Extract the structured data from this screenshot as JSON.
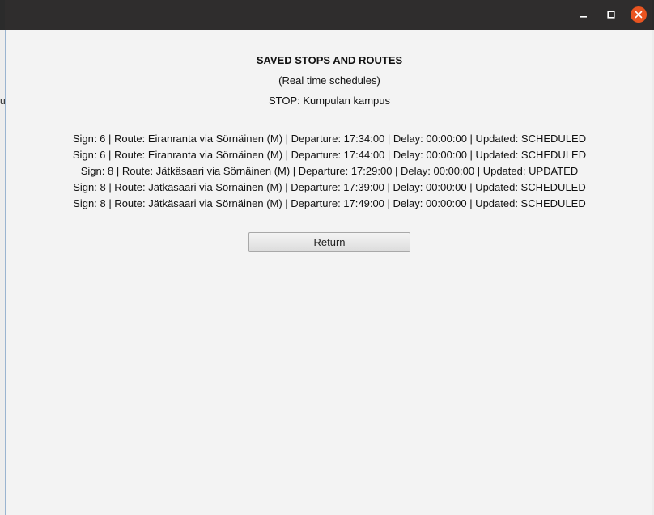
{
  "window": {
    "controls": {
      "minimize_icon": "minimize-icon",
      "maximize_icon": "maximize-icon",
      "close_icon": "close-icon",
      "close_color": "#e95420"
    }
  },
  "desktop": {
    "left_glyph": "u"
  },
  "main": {
    "title": "SAVED STOPS AND ROUTES",
    "subtitle": "(Real time schedules)",
    "stop": "STOP: Kumpulan kampus",
    "schedules": [
      "Sign: 6 | Route: Eiranranta via Sörnäinen (M) | Departure: 17:34:00 | Delay: 00:00:00 | Updated: SCHEDULED",
      "Sign: 6 | Route: Eiranranta via Sörnäinen (M) | Departure: 17:44:00 | Delay: 00:00:00 | Updated: SCHEDULED",
      "Sign: 8 | Route: Jätkäsaari via Sörnäinen (M) | Departure: 17:29:00 | Delay: 00:00:00 | Updated: UPDATED",
      "Sign: 8 | Route: Jätkäsaari via Sörnäinen (M) | Departure: 17:39:00 | Delay: 00:00:00 | Updated: SCHEDULED",
      "Sign: 8 | Route: Jätkäsaari via Sörnäinen (M) | Departure: 17:49:00 | Delay: 00:00:00 | Updated: SCHEDULED"
    ],
    "return_label": "Return"
  }
}
